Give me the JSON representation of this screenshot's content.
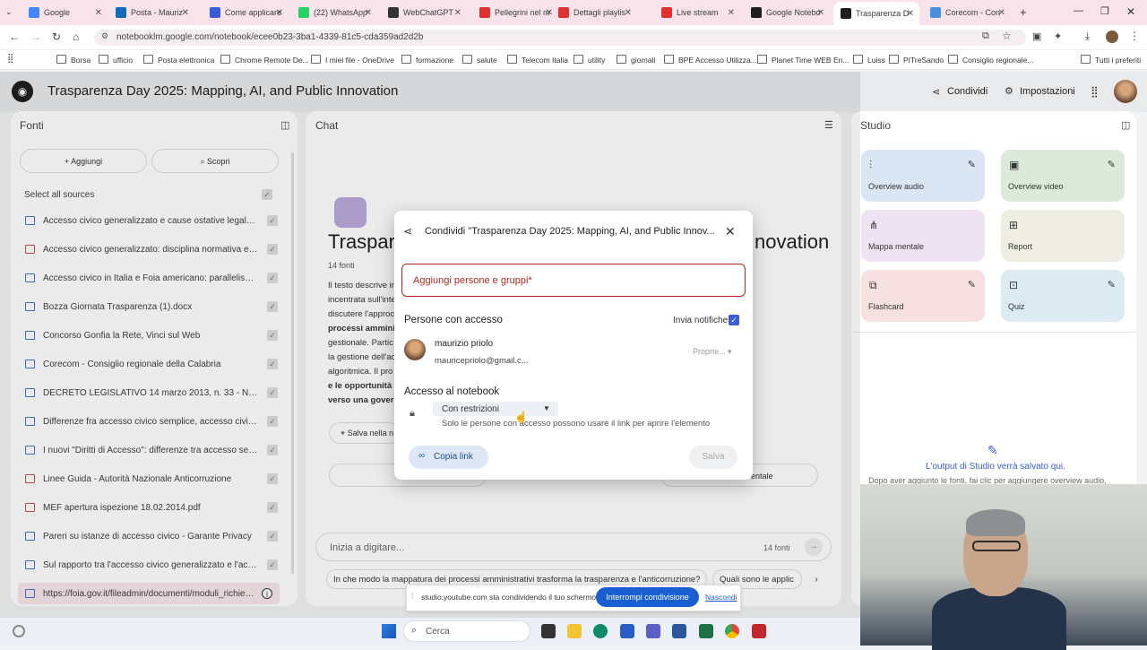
{
  "browser": {
    "tabs": [
      {
        "label": "Google",
        "color": "#4285f4"
      },
      {
        "label": "Posta - Mauriz",
        "color": "#0f6cbd"
      },
      {
        "label": "Come applicare",
        "color": "#3b5bdb"
      },
      {
        "label": "(22) WhatsApp",
        "color": "#25d366"
      },
      {
        "label": "WebChatGPT",
        "color": "#333333"
      },
      {
        "label": "Pellegrini nel m",
        "color": "#e03131"
      },
      {
        "label": "Dettagli playlis",
        "color": "#e03131"
      },
      {
        "label": "Live stream",
        "color": "#e03131"
      },
      {
        "label": "Google Notebo",
        "color": "#1f1f1f"
      },
      {
        "label": "Trasparenza D",
        "color": "#1f1f1f"
      },
      {
        "label": "Corecom - Con",
        "color": "#4a90e2"
      }
    ],
    "url": "notebooklm.google.com/notebook/ecee0b23-3ba1-4339-81c5-cda359ad2d2b",
    "bookmarks": [
      "Borsa",
      "ufficio",
      "Posta elettronica",
      "Chrome Remote De...",
      "I miei file - OneDrive",
      "formazione",
      "salute",
      "Telecom Italia",
      "utility",
      "giornali",
      "BPE Accesso Utilizza...",
      "Planet Time WEB En...",
      "Luiss",
      "PITreSando",
      "Consiglio regionale...",
      "Tutti i preferiti"
    ]
  },
  "app": {
    "title": "Trasparenza Day 2025: Mapping, AI, and Public Innovation",
    "share_label": "Condividi",
    "settings_label": "Impostazioni"
  },
  "fonti": {
    "header": "Fonti",
    "add_label": "Aggiungi",
    "discover_label": "Scopri",
    "select_all": "Select all sources",
    "sources": [
      {
        "label": "Accesso civico generalizzato e cause ostative legalme...",
        "type": "doc"
      },
      {
        "label": "Accesso civico generalizzato: disciplina normativa e pr...",
        "type": "pdf"
      },
      {
        "label": "Accesso civico in Italia e Foia americano: parallelismi e...",
        "type": "doc"
      },
      {
        "label": "Bozza Giornata Trasparenza (1).docx",
        "type": "doc"
      },
      {
        "label": "Concorso Gonfia la Rete, Vinci sul Web",
        "type": "doc"
      },
      {
        "label": "Corecom - Consiglio regionale della Calabria",
        "type": "doc"
      },
      {
        "label": "DECRETO LEGISLATIVO 14 marzo 2013, n. 33 - Norma...",
        "type": "doc"
      },
      {
        "label": "Differenze fra accesso civico semplice, accesso civico ...",
        "type": "doc"
      },
      {
        "label": "I nuovi \"Diritti di Accesso\": differenze tra accesso sem...",
        "type": "doc"
      },
      {
        "label": "Linee Guida - Autorità Nazionale Anticorruzione",
        "type": "pdf"
      },
      {
        "label": "MEF apertura ispezione 18.02.2014.pdf",
        "type": "pdf"
      },
      {
        "label": "Pareri su istanze di accesso civico - Garante Privacy",
        "type": "doc"
      },
      {
        "label": "Sul rapporto tra l'accesso civico generalizzato e l'acce...",
        "type": "doc"
      },
      {
        "label": "https://foia.gov.it/fileadmin/documenti/moduli_richiede...",
        "type": "doc"
      }
    ]
  },
  "chat": {
    "header": "Chat",
    "title_partial": "Traspare",
    "title_tail": "novation",
    "source_count": "14 fonti",
    "summary_lines": [
      "Il testo descrive in",
      "incentrata sull'inte",
      "discutere l'approc",
      "processi ammini",
      "gestionale. Partic",
      "la gestione dell'ac",
      "algoritmica. Il pro",
      "e le opportunità",
      "verso una govern"
    ],
    "save_note": "Salva nella n",
    "input_placeholder": "Inizia a digitare...",
    "input_count": "14 fonti",
    "suggestion_1": "In che modo la mappatura dei processi amministrativi trasforma la trasparenza e l'anticorruzione?",
    "suggestion_2": "Quali sono le applic"
  },
  "studio": {
    "header": "Studio",
    "cards": [
      {
        "label": "Overview audio",
        "bg": "#dbe6f5"
      },
      {
        "label": "Overview video",
        "bg": "#dcebd9"
      },
      {
        "label": "Mappa mentale",
        "bg": "#eee3f2"
      },
      {
        "label": "Report",
        "bg": "#efeee2"
      },
      {
        "label": "Flashcard",
        "bg": "#f7e0e0"
      },
      {
        "label": "Quiz",
        "bg": "#dcebf1"
      }
    ],
    "output_title": "L'output di Studio verrà salvato qui.",
    "output_desc": "Dopo aver aggiunto le fonti, fai clic per aggiungere overview audio,"
  },
  "modal": {
    "title": "Condividi \"Trasparenza Day 2025: Mapping, AI, and Public Innov...",
    "add_people_placeholder": "Aggiungi persone e gruppi*",
    "people_header": "Persone con accesso",
    "notify_label": "Invia notifiche",
    "user_name": "maurizio priolo",
    "user_email": "mauricepriolo@gmail.c...",
    "user_role": "Proprie...",
    "access_header": "Accesso al notebook",
    "access_value": "Con restrizioni",
    "access_help": "Solo le persone con accesso possono usare il link per aprire l'elemento",
    "copy_link": "Copia link",
    "save": "Salva"
  },
  "sharebar": {
    "message": "studio.youtube.com sta condividendo il tuo schermo.",
    "stop_label": "Interrompi condivisione",
    "hide_label": "Nascondi"
  },
  "taskbar": {
    "search_placeholder": "Cerca"
  }
}
